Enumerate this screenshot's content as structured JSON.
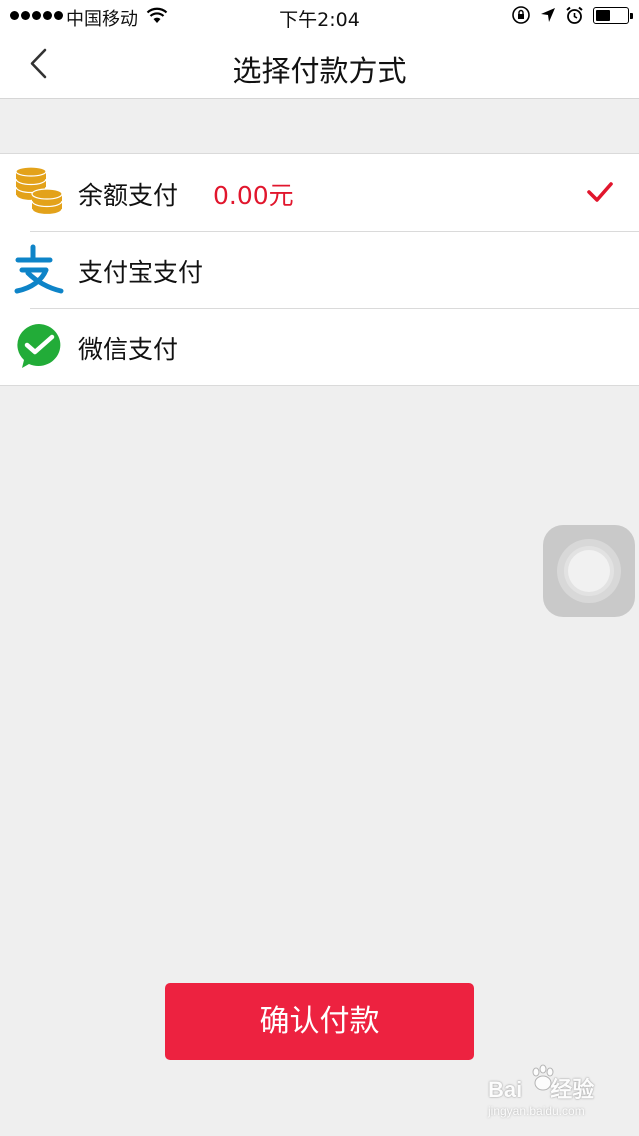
{
  "status_bar": {
    "carrier": "中国移动",
    "time": "下午2:04"
  },
  "nav": {
    "title": "选择付款方式",
    "back_icon": "chevron-left-icon"
  },
  "payment_options": [
    {
      "label": "余额支付",
      "balance": "0.00元",
      "icon": "coins-icon",
      "selected": true
    },
    {
      "label": "支付宝支付",
      "icon": "alipay-icon",
      "selected": false
    },
    {
      "label": "微信支付",
      "icon": "wechat-pay-icon",
      "selected": false
    }
  ],
  "confirm_button": {
    "label": "确认付款"
  },
  "watermark": {
    "brand": "Bai",
    "brand_suffix": "经验",
    "url": "jingyan.baidu.com"
  },
  "colors": {
    "accent": "#ed2240",
    "balance_text": "#e1162d",
    "background": "#efefef"
  }
}
